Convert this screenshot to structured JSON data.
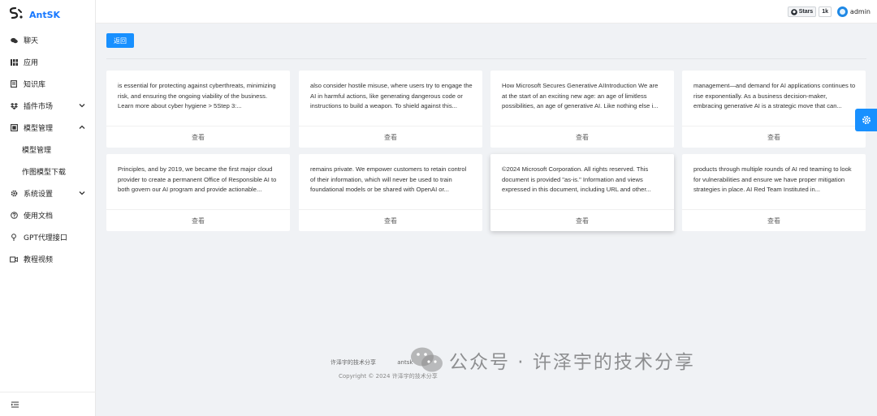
{
  "brand": {
    "logo": "϶\\.",
    "name": "AntSK"
  },
  "sidebar": {
    "items": [
      {
        "label": "聊天",
        "icon": "chat-icon"
      },
      {
        "label": "应用",
        "icon": "apps-icon"
      },
      {
        "label": "知识库",
        "icon": "book-icon"
      },
      {
        "label": "插件市场",
        "icon": "dropbox-icon",
        "expanded": false
      },
      {
        "label": "模型管理",
        "icon": "model-icon",
        "expanded": true
      },
      {
        "label": "系统设置",
        "icon": "gear-icon",
        "expanded": false
      },
      {
        "label": "使用文档",
        "icon": "question-icon"
      },
      {
        "label": "GPT代理接口",
        "icon": "pin-icon"
      },
      {
        "label": "教程视频",
        "icon": "video-icon"
      }
    ],
    "model_sub_items": [
      {
        "label": "模型管理"
      },
      {
        "label": "作图模型下载"
      }
    ]
  },
  "header": {
    "github_button": "Stars",
    "github_count": "1k",
    "user_name": "admin"
  },
  "main": {
    "back_label": "返回",
    "view_label": "查看",
    "cards": [
      {
        "text": "is essential for protecting against cyberthreats, minimizing risk, and ensuring the ongoing viability of the business. Learn more about cyber hygiene > 5Step 3:..."
      },
      {
        "text": "also consider hostile misuse, where users try to engage the AI in harmful actions, like generating dangerous code or instructions to build a weapon. To shield against this..."
      },
      {
        "text": "How Microsoft Secures Generative AIIntroduction We are at the start of an exciting new age: an age of limitless possibilities, an age of generative AI. Like nothing else i..."
      },
      {
        "text": "management—and demand for AI applications continues to rise exponentially. As a business decision-maker, embracing generative AI is a strategic move that can..."
      },
      {
        "text": "Principles, and by 2019, we became the first major cloud provider to create a permanent Office of Responsible AI to both govern our AI program and provide actionable..."
      },
      {
        "text": "remains private. We empower customers to retain control of their information, which will never be used to train foundational models or be shared with OpenAI or..."
      },
      {
        "text": "©2024 Microsoft Corporation. All rights reserved. This document is provided \"as-is.\" Information and views expressed in this document, including URL and other..."
      },
      {
        "text": "products through multiple rounds of AI red teaming to look for vulnerabilities and ensure we have proper mitigation strategies in place. AI Red Team Instituted in..."
      }
    ]
  },
  "footer": {
    "link_author": "许泽宇的技术分享",
    "link_github": "antsk",
    "copyright": "Copyright © 2024 许泽宇的技术分享"
  },
  "watermark": "公众号 · 许泽宇的技术分享",
  "colors": {
    "primary": "#1890ff",
    "brand": "#1677ff",
    "background": "#f0f2f5"
  }
}
